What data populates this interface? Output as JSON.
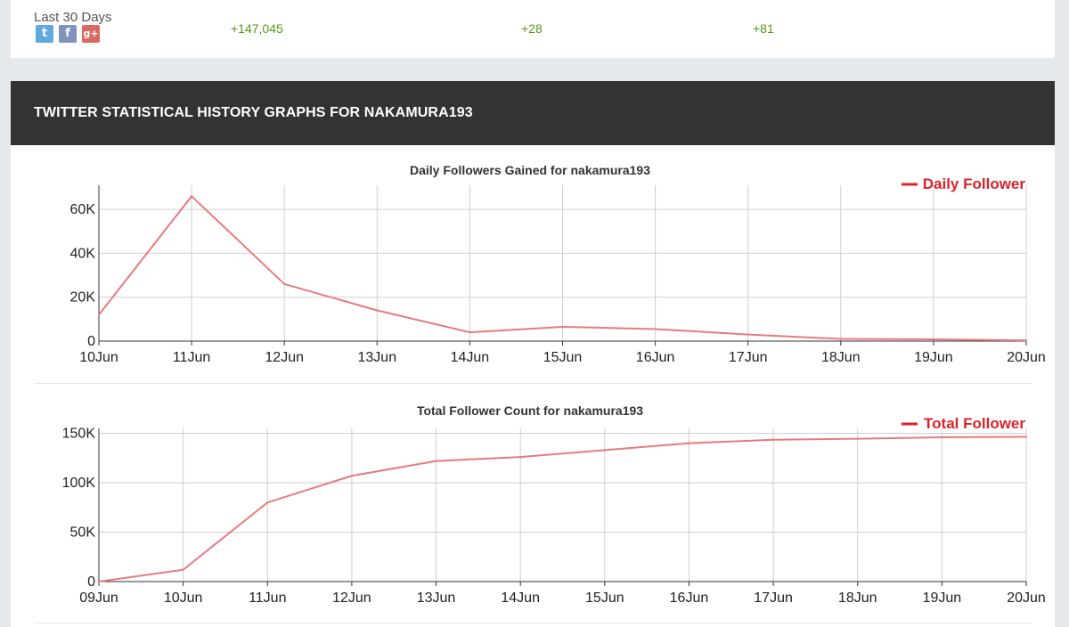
{
  "summary": {
    "period_label": "Last 30 Days",
    "icons": [
      "twitter-icon",
      "facebook-icon",
      "google-plus-icon"
    ],
    "stats": [
      "+147,045",
      "+28",
      "+81"
    ],
    "stat_color": "#4f9a18"
  },
  "section": {
    "title": "TWITTER STATISTICAL HISTORY GRAPHS FOR NAKAMURA193",
    "header_bg": "#333333"
  },
  "chart_data": [
    {
      "type": "line",
      "title": "Daily Followers Gained for nakamura193",
      "x": [
        "10Jun",
        "11Jun",
        "12Jun",
        "13Jun",
        "14Jun",
        "15Jun",
        "16Jun",
        "17Jun",
        "18Jun",
        "19Jun",
        "20Jun"
      ],
      "series": [
        {
          "name": "Daily Follower",
          "color": "#e77b7b",
          "values": [
            12000,
            66000,
            26000,
            14000,
            4000,
            6500,
            5500,
            3000,
            1000,
            800,
            300
          ]
        }
      ],
      "yticks": [
        0,
        20000,
        40000,
        60000
      ],
      "ytick_labels": [
        "0",
        "20K",
        "40K",
        "60K"
      ],
      "ylim": [
        0,
        71000
      ],
      "grid": true,
      "legend": "top-right",
      "legend_color": "#d8232a"
    },
    {
      "type": "line",
      "title": "Total Follower Count for nakamura193",
      "x": [
        "09Jun",
        "10Jun",
        "11Jun",
        "12Jun",
        "13Jun",
        "14Jun",
        "15Jun",
        "16Jun",
        "17Jun",
        "18Jun",
        "19Jun",
        "20Jun"
      ],
      "series": [
        {
          "name": "Total Follower",
          "color": "#e77b7b",
          "values": [
            0,
            12000,
            80000,
            107000,
            122000,
            126000,
            133000,
            140000,
            143500,
            144500,
            146000,
            146500
          ]
        }
      ],
      "yticks": [
        0,
        50000,
        100000,
        150000
      ],
      "ytick_labels": [
        "0",
        "50K",
        "100K",
        "150K"
      ],
      "ylim": [
        0,
        155000
      ],
      "grid": true,
      "legend": "top-right",
      "legend_color": "#d8232a"
    }
  ]
}
